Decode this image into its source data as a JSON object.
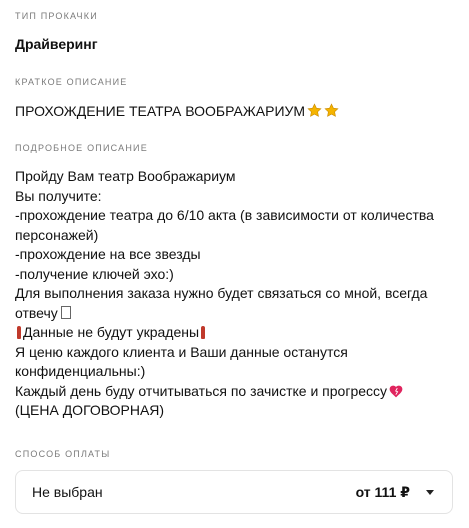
{
  "boost_type": {
    "label": "ТИП ПРОКАЧКИ",
    "value": "Драйверинг"
  },
  "short_description": {
    "label": "КРАТКОЕ ОПИСАНИЕ",
    "value": "ПРОХОЖДЕНИЕ ТЕАТРА ВООБРАЖАРИУМ",
    "trailing_icons": [
      "star-icon",
      "star-icon"
    ]
  },
  "full_description": {
    "label": "ПОДРОБНОЕ ОПИСАНИЕ",
    "lines": [
      "Пройду Вам театр Воображариум",
      "Вы получите:",
      "-прохождение театра до 6/10 акта (в зависимости от количества",
      "персонажей)",
      "-прохождение на все звезды",
      "-получение ключей эхо:)",
      "Для выполнения заказа нужно будет связаться со мной, всегда",
      "отвечу",
      "Данные не будут украдены",
      "Я ценю каждого клиента и Ваши данные останутся",
      "конфиденциальны:)",
      "Каждый день буду отчитываться по зачистке и прогрессу",
      "(ЦЕНА ДОГОВОРНАЯ)"
    ],
    "icons": {
      "missing_glyph": "missing-glyph-icon",
      "exclamation": "exclamation-icon",
      "heart": "heart-icon"
    },
    "colors": {
      "exclamation": "#c0392b",
      "heart": "#e0245e",
      "star": "#f5b400"
    }
  },
  "payment": {
    "label": "СПОСОБ ОПЛАТЫ",
    "selected": "Не выбран",
    "price": "от 111 ₽",
    "dropdown_icon": "chevron-down-icon"
  }
}
